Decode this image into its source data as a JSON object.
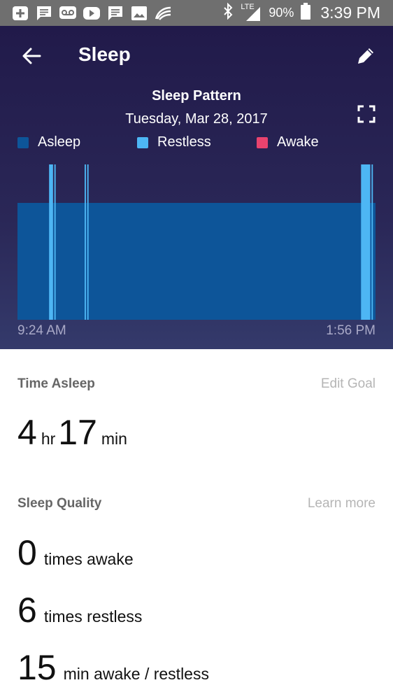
{
  "status_bar": {
    "icons": [
      "add-box-icon",
      "message-icon",
      "voicemail-icon",
      "youtube-icon",
      "message-icon",
      "image-icon",
      "swiftkey-icon"
    ],
    "right_icons": [
      "bluetooth-icon",
      "lte-signal-icon",
      "battery-icon"
    ],
    "network": "LTE",
    "battery": "90%",
    "time": "3:39 PM"
  },
  "header": {
    "title": "Sleep",
    "back_icon": "arrow-left-icon",
    "edit_icon": "pencil-icon",
    "expand_icon": "fullscreen-icon"
  },
  "chart_data": {
    "type": "area",
    "title": "Sleep Pattern",
    "subtitle": "Tuesday, Mar 28, 2017",
    "legend": [
      {
        "name": "Asleep",
        "color": "#0d5599"
      },
      {
        "name": "Restless",
        "color": "#4db6f4"
      },
      {
        "name": "Awake",
        "color": "#e8436e"
      }
    ],
    "x_start": "9:24 AM",
    "x_end": "1:56 PM",
    "asleep_intervals": [
      [
        "9:24 AM",
        "1:56 PM"
      ]
    ],
    "restless_intervals": [
      [
        "9:48 AM",
        "9:51 AM"
      ],
      [
        "9:52 AM",
        "9:53 AM"
      ],
      [
        "10:15 AM",
        "10:16 AM"
      ],
      [
        "10:17 AM",
        "10:18 AM"
      ],
      [
        "1:45 PM",
        "1:52 PM"
      ],
      [
        "1:53 PM",
        "1:54 PM"
      ]
    ],
    "awake_intervals": [],
    "legend_placement": "top",
    "grid": false
  },
  "time_asleep": {
    "title": "Time Asleep",
    "link": "Edit Goal",
    "hours": "4",
    "hours_unit": "hr",
    "minutes": "17",
    "minutes_unit": "min"
  },
  "sleep_quality": {
    "title": "Sleep Quality",
    "link": "Learn more",
    "rows": [
      {
        "value": "0",
        "label": "times awake"
      },
      {
        "value": "6",
        "label": "times restless"
      },
      {
        "value": "15",
        "label": "min awake / restless"
      }
    ]
  }
}
